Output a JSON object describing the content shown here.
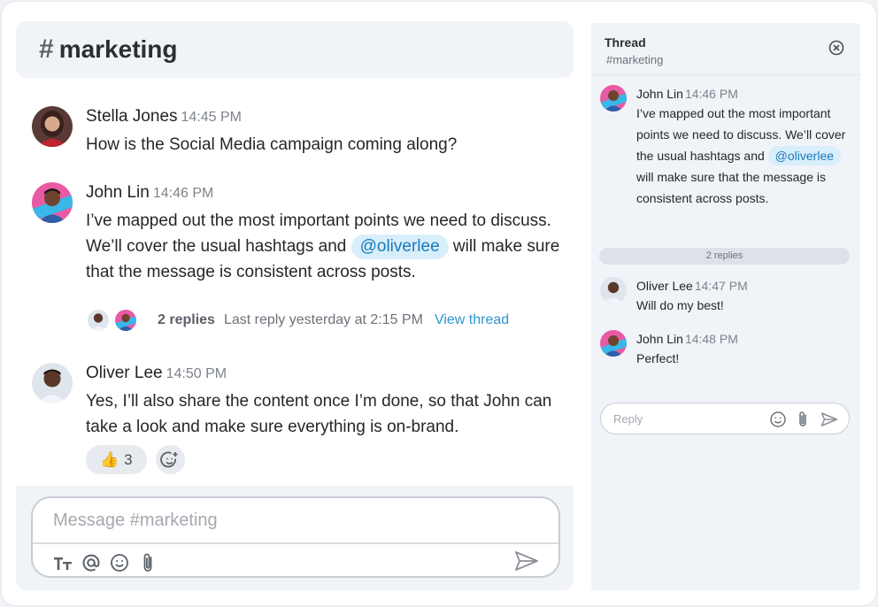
{
  "channel": {
    "hash": "#",
    "name": "marketing"
  },
  "messages": [
    {
      "author": "Stella Jones",
      "time": "14:45 PM",
      "text": " How is the Social Media campaign coming along?"
    },
    {
      "author": "John Lin",
      "time": "14:46 PM",
      "text_before": "I’ve mapped out the most important points we need to discuss. We’ll cover the usual hashtags and ",
      "mention": "@oliverlee",
      "text_after": " will make sure that the message is consistent across posts."
    },
    {
      "author": "Oliver Lee",
      "time": "14:50 PM",
      "text": "Yes, I’ll also share the content once I’m done, so that John can take a look and make sure everything is on-brand."
    }
  ],
  "thread_summary": {
    "count": "2 replies",
    "last_reply": "Last reply yesterday at 2:15 PM",
    "view": "View thread"
  },
  "reaction": {
    "emoji": "👍",
    "count": "3"
  },
  "composer": {
    "placeholder": "Message #marketing"
  },
  "thread": {
    "title": "Thread",
    "channel": "#marketing",
    "parent": {
      "author": "John Lin",
      "time": "14:46 PM",
      "text_before": "I’ve mapped out the most important points we need to discuss. We’ll cover the usual hashtags and ",
      "mention": "@oliverlee",
      "text_after": " will make sure that the message is consistent across posts."
    },
    "replies_label": "2 replies",
    "replies": [
      {
        "author": "Oliver Lee",
        "time": "14:47 PM",
        "text": "Will do my best!"
      },
      {
        "author": "John Lin",
        "time": "14:48 PM",
        "text": "Perfect!"
      }
    ],
    "reply_placeholder": "Reply"
  },
  "colors": {
    "accent": "#2a97d4",
    "mention_bg": "#d9eefb",
    "panel_bg": "#f0f3f7"
  }
}
